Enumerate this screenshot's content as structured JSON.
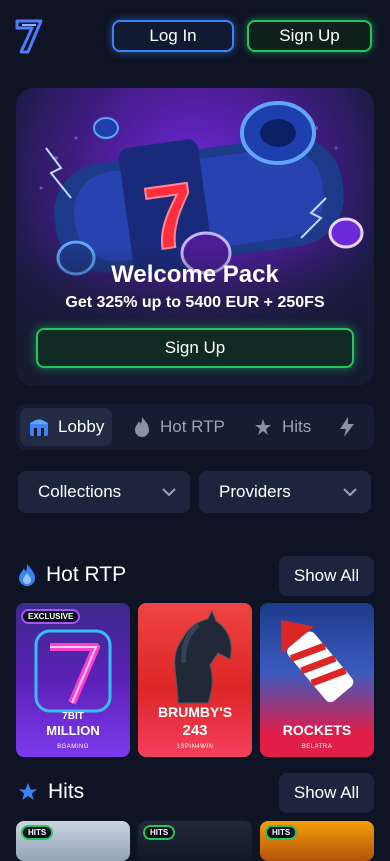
{
  "header": {
    "login_label": "Log In",
    "signup_label": "Sign Up"
  },
  "hero": {
    "title": "Welcome Pack",
    "subtitle": "Get 325% up to 5400 EUR + 250FS",
    "cta_label": "Sign Up"
  },
  "tabs": [
    {
      "label": "Lobby",
      "icon": "lobby-icon",
      "active": true
    },
    {
      "label": "Hot RTP",
      "icon": "flame-icon",
      "active": false
    },
    {
      "label": "Hits",
      "icon": "stars-icon",
      "active": false
    },
    {
      "label": "",
      "icon": "bolt-icon",
      "active": false
    }
  ],
  "filters": {
    "collections_label": "Collections",
    "providers_label": "Providers"
  },
  "sections": {
    "hot_rtp": {
      "title": "Hot RTP",
      "show_all": "Show All",
      "games": [
        {
          "badge": "EXCLUSIVE",
          "name_line1": "7BIT",
          "name_line2": "MILLION",
          "provider": "BGAMING"
        },
        {
          "badge": "",
          "name_line1": "BRUMBY'S",
          "name_line2": "243",
          "provider": "1SPIN4WIN"
        },
        {
          "badge": "",
          "name_line1": "ROCKETS",
          "name_line2": "",
          "provider": "BELATRA"
        }
      ]
    },
    "hits": {
      "title": "Hits",
      "show_all": "Show All",
      "badges": [
        "HITS",
        "HITS",
        "HITS"
      ]
    }
  },
  "colors": {
    "background": "#0f1424",
    "accent_blue": "#3b82f6",
    "accent_green": "#22c55e",
    "panel": "#1d243d"
  }
}
